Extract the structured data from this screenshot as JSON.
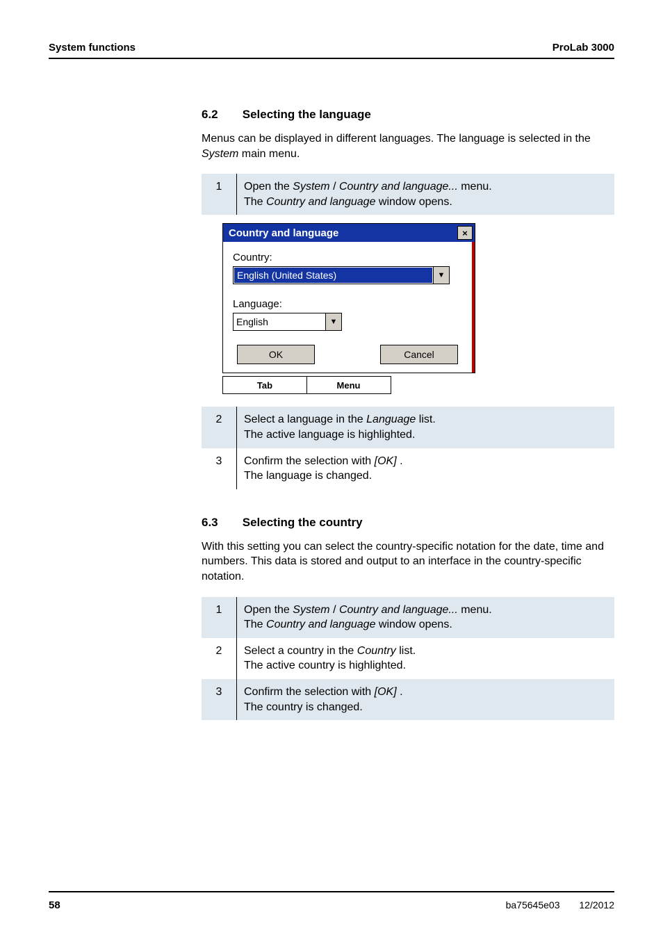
{
  "header": {
    "left": "System functions",
    "right": "ProLab 3000"
  },
  "section62": {
    "number": "6.2",
    "title": "Selecting the language",
    "intro_part1": "Menus can be displayed in different languages. The language is selected in the ",
    "intro_italic": "System",
    "intro_part2": " main menu.",
    "step1_num": "1",
    "step1_text_a": "Open the ",
    "step1_text_b": "System",
    "step1_text_c": " / ",
    "step1_text_d": "Country and language...",
    "step1_text_e": " menu.",
    "step1_line2_a": "The ",
    "step1_line2_b": "Country and language",
    "step1_line2_c": " window opens.",
    "step2_num": "2",
    "step2_a": "Select a language in the ",
    "step2_b": "Language",
    "step2_c": " list.",
    "step2_line2": "The active language is highlighted.",
    "step3_num": "3",
    "step3_a": "Confirm the selection with ",
    "step3_b": "[OK]",
    "step3_c": " .",
    "step3_line2": "The language is changed."
  },
  "dialog": {
    "title": "Country and language",
    "close": "×",
    "country_label": "Country:",
    "country_value": "English (United States)",
    "language_label": "Language:",
    "language_value": "English",
    "ok": "OK",
    "cancel": "Cancel",
    "tab": "Tab",
    "menu": "Menu"
  },
  "section63": {
    "number": "6.3",
    "title": "Selecting the country",
    "intro": "With this setting you can select the country-specific notation for the date, time and numbers. This data is stored and output to an interface in the country-specific notation.",
    "step1_num": "1",
    "step1_text_a": "Open the ",
    "step1_text_b": "System",
    "step1_text_c": " / ",
    "step1_text_d": "Country and language...",
    "step1_text_e": " menu.",
    "step1_line2_a": "The ",
    "step1_line2_b": "Country and language",
    "step1_line2_c": " window opens.",
    "step2_num": "2",
    "step2_a": "Select a country in the ",
    "step2_b": "Country",
    "step2_c": " list.",
    "step2_line2": "The active country is highlighted.",
    "step3_num": "3",
    "step3_a": "Confirm the selection with ",
    "step3_b": "[OK]",
    "step3_c": " .",
    "step3_line2": "The country is changed."
  },
  "footer": {
    "page": "58",
    "docid": "ba75645e03",
    "date": "12/2012"
  }
}
